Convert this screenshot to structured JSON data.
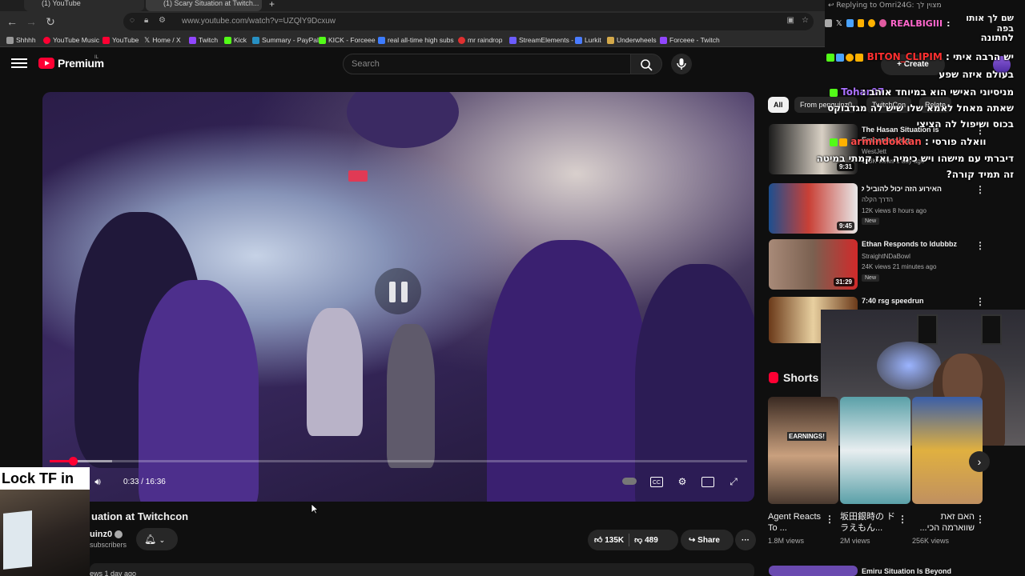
{
  "browser": {
    "tabs": [
      "(1) YouTube",
      "(1) Scary Situation at Twitch..."
    ],
    "url": "www.youtube.com/watch?v=UZQlY9Dcxuw",
    "bookmarks": [
      {
        "label": "Shhhh",
        "color": "#999999"
      },
      {
        "label": "YouTube Music",
        "color": "#ff0033"
      },
      {
        "label": "YouTube",
        "color": "#ff0033"
      },
      {
        "label": "Home / X",
        "color": "#ffffff"
      },
      {
        "label": "Twitch",
        "color": "#9146ff"
      },
      {
        "label": "Kick",
        "color": "#53fc18"
      },
      {
        "label": "Summary - PayPal",
        "color": "#2790c3"
      },
      {
        "label": "KICK - Forceee",
        "color": "#53fc18"
      },
      {
        "label": "real all-time high subs",
        "color": "#3d7cff"
      },
      {
        "label": "mr raindrop",
        "color": "#e03030"
      },
      {
        "label": "StreamElements -",
        "color": "#6c5cff"
      },
      {
        "label": "Lurkit",
        "color": "#4a7cff"
      },
      {
        "label": "Underwheels",
        "color": "#d4a94a"
      },
      {
        "label": "Forceee - Twitch",
        "color": "#9146ff"
      }
    ]
  },
  "header": {
    "logo_text": "Premium",
    "country": "IL",
    "search_placeholder": "Search",
    "create_label": "Create"
  },
  "player": {
    "time": "0:33 / 16:36",
    "progress_played": 0.033,
    "progress_buffered": 0.09
  },
  "video": {
    "title": "uation at Twitchcon",
    "channel": "uinz0",
    "subscribers": "subscribers",
    "likes": "135K",
    "dislikes": "489",
    "share_label": "Share",
    "views_line": "ews  1 day ago"
  },
  "overlay": {
    "caption": "Lock TF in"
  },
  "sidebar": {
    "chips": [
      "All",
      "From penguinz0",
      "TwitchCon",
      "Relate"
    ],
    "recommended": [
      {
        "title": "The Hasan Situation is",
        "title2": "Embarrassing",
        "channel": "WestJett",
        "meta": "123K views  1 day ago",
        "duration": "9:31",
        "colors": [
          "#1c1c1c",
          "#d8d0c4"
        ]
      },
      {
        "title": "האירוע הזה יכול להוביל לפיצוץ",
        "channel": "הדרך הקלה",
        "meta": "12K views  8 hours ago",
        "badge": "New",
        "duration": "9:45",
        "colors": [
          "#1d4f8f",
          "#c94036"
        ]
      },
      {
        "title": "Ethan Responds to Idubbbz",
        "channel": "StraightNDaBowl",
        "meta": "24K views  21 minutes ago",
        "badge": "New",
        "duration": "31:29",
        "colors": [
          "#a88a78",
          "#d12a2a"
        ]
      },
      {
        "title": "7:40 rsg speedrun",
        "channel": "",
        "meta": "",
        "duration": "",
        "colors": [
          "#6b3a1a",
          "#e8d0a0"
        ]
      }
    ],
    "bottom_item": {
      "title": "Emiru Situation Is Beyond"
    },
    "shorts_label": "Shorts",
    "shorts": [
      {
        "title": "Agent Reacts To ...",
        "views": "1.8M views",
        "caption": "EARNINGS!",
        "colors": [
          "#3a2a22",
          "#c9a07e"
        ]
      },
      {
        "title": "坂田銀時の ドラえもん...",
        "views": "2M views",
        "colors": [
          "#5aa0a8",
          "#e8eef0"
        ]
      },
      {
        "title": "האם זאת שווארמה הכי...",
        "views": "256K views",
        "colors": [
          "#3a5ea8",
          "#e0b040"
        ]
      }
    ]
  },
  "chat": {
    "reply_to": "Replying to Omri24G: מצוין לך",
    "messages": [
      {
        "user": "REALBIGIII",
        "user_color": "#ff66cc",
        "text": "שם לך אותו בפה",
        "line2": "לחתונה"
      },
      {
        "user": "BITON_CLIPIM",
        "user_color": "#ff3030",
        "text": "יש הרבה איתי",
        "line2": "בעולם איזה שפע"
      },
      {
        "user": "Tohar07",
        "user_color": "#a970ff",
        "text": "מניסיוני האישי הוא במיוחד אוהב",
        "line2": "שאתה מאחל לאמא שלו שיש לה מגדבוקס",
        "line3": "בכוס ושיפול לה הציצי"
      },
      {
        "user": "armindokkan",
        "user_color": "#ff4d4d",
        "text": "וואלה פורסי",
        "line2": "דיברתי עם מישהו ויש כימיה ואז קמתי במיטה",
        "line3": "זה תמיד קורה?"
      }
    ]
  }
}
